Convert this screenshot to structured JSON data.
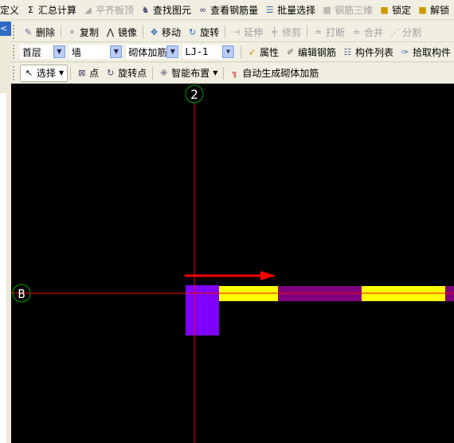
{
  "toolbar1": {
    "items": [
      {
        "label": "定义",
        "icon": "none",
        "disabled": false
      },
      {
        "label": "汇总计算",
        "icon": "sigma-icon",
        "disabled": false
      },
      {
        "label": "平齐板顶",
        "icon": "align-top-icon",
        "disabled": true
      },
      {
        "label": "查找图元",
        "icon": "binoculars-icon",
        "disabled": false
      },
      {
        "label": "查看钢筋量",
        "icon": "glasses-icon",
        "disabled": false
      },
      {
        "label": "批量选择",
        "icon": "batch-select-icon",
        "disabled": false
      },
      {
        "label": "钢筋三维",
        "icon": "rebar-3d-icon",
        "disabled": true
      },
      {
        "label": "锁定",
        "icon": "lock-icon",
        "disabled": false
      },
      {
        "label": "解锁",
        "icon": "unlock-icon",
        "disabled": false
      }
    ]
  },
  "toolbar2": {
    "items": [
      {
        "label": "删除",
        "disabled": false
      },
      {
        "label": "复制",
        "disabled": false
      },
      {
        "label": "镜像",
        "disabled": false
      },
      {
        "label": "移动",
        "disabled": false
      },
      {
        "label": "旋转",
        "disabled": false
      },
      {
        "label": "延伸",
        "disabled": true
      },
      {
        "label": "修剪",
        "disabled": true
      },
      {
        "label": "打断",
        "disabled": true
      },
      {
        "label": "合并",
        "disabled": true
      },
      {
        "label": "分割",
        "disabled": true
      }
    ]
  },
  "toolbar3": {
    "floor": "首层",
    "category": "墙",
    "type": "砌体加筋",
    "component": "LJ-1",
    "buttons": [
      "属性",
      "编辑钢筋",
      "构件列表",
      "拾取构件"
    ]
  },
  "toolbar4": {
    "select": "选择",
    "point": "点",
    "rotate_point": "旋转点",
    "smart_layout": "智能布置",
    "auto_generate": "自动生成砌体加筋"
  },
  "left_panel": {
    "collapse_glyph": "<"
  },
  "canvas": {
    "axis_vertical_label": "2",
    "axis_horizontal_label": "B",
    "colors": {
      "background": "#000000",
      "axis": "#ff0000",
      "axis_circle": "#00a000",
      "column": "#8000ff",
      "wall_yellow": "#ffff00",
      "wall_purple": "#800080",
      "arrow": "#ff0000"
    }
  }
}
